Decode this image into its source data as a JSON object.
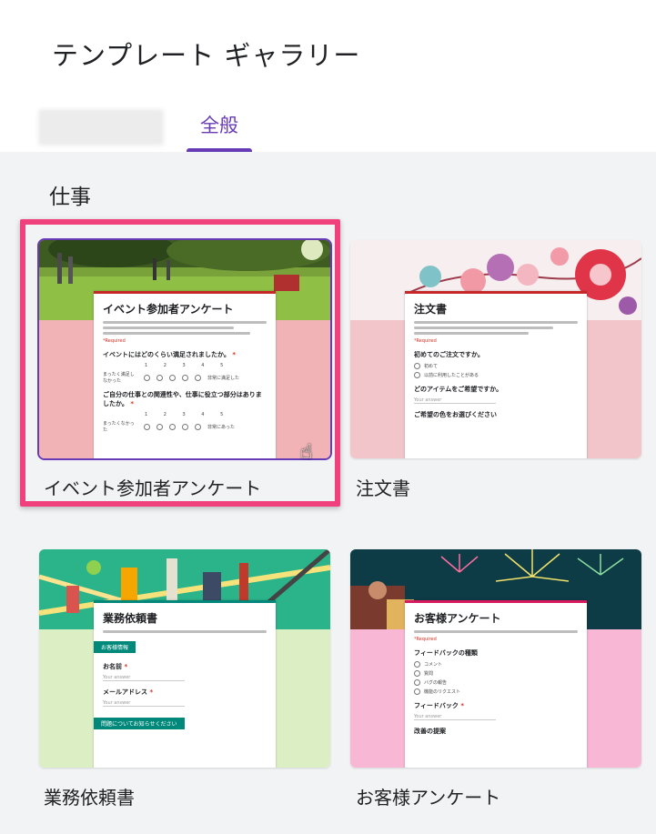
{
  "header": {
    "title": "テンプレート ギャラリー",
    "tabs": [
      {
        "label": "全般",
        "active": true
      }
    ]
  },
  "section": {
    "title": "仕事"
  },
  "templates": [
    {
      "name": "イベント参加者アンケート",
      "selected": true,
      "thumbnail": {
        "form_title": "イベント参加者アンケート",
        "required_note": "*Required",
        "questions": [
          "イベントにはどのくらい満足されましたか。",
          "ご自分の仕事との関連性や、仕事に役立つ部分はありましたか。"
        ],
        "scale_numbers": "1 2 3 4 5",
        "scale_left_1": "まったく満足しなかった",
        "scale_right_1": "非常に満足した",
        "scale_left_2": "まったくなかった",
        "scale_right_2": "非常にあった"
      }
    },
    {
      "name": "注文書",
      "selected": false,
      "thumbnail": {
        "form_title": "注文書",
        "required_note": "*Required",
        "questions": [
          "初めてのご注文ですか。",
          "どのアイテムをご希望ですか。",
          "ご希望の色をお選びください"
        ],
        "options": [
          "初めて",
          "以前に利用したことがある"
        ],
        "answer_placeholder": "Your answer"
      }
    },
    {
      "name": "業務依頼書",
      "selected": false,
      "thumbnail": {
        "form_title": "業務依頼書",
        "section_1": "お客様情報",
        "section_2": "問題についてお知らせください",
        "questions": [
          "お名前",
          "メールアドレス"
        ],
        "answer_placeholder": "Your answer"
      }
    },
    {
      "name": "お客様アンケート",
      "selected": false,
      "thumbnail": {
        "form_title": "お客様アンケート",
        "required_note": "*Required",
        "questions": [
          "フィードバックの種類",
          "フィードバック",
          "改善の提案"
        ],
        "options": [
          "コメント",
          "質問",
          "バグの報告",
          "機能のリクエスト"
        ],
        "answer_placeholder": "Your answer"
      }
    }
  ],
  "colors": {
    "accent": "#673ab7",
    "highlight": "#f0417d",
    "event_bg": "#f2b3b6",
    "order_bg": "#f1c5c9",
    "request_bg": "#dcefc4",
    "survey_bg": "#f9b7d6"
  },
  "icons": {
    "cursor": "hand-pointer-icon"
  }
}
